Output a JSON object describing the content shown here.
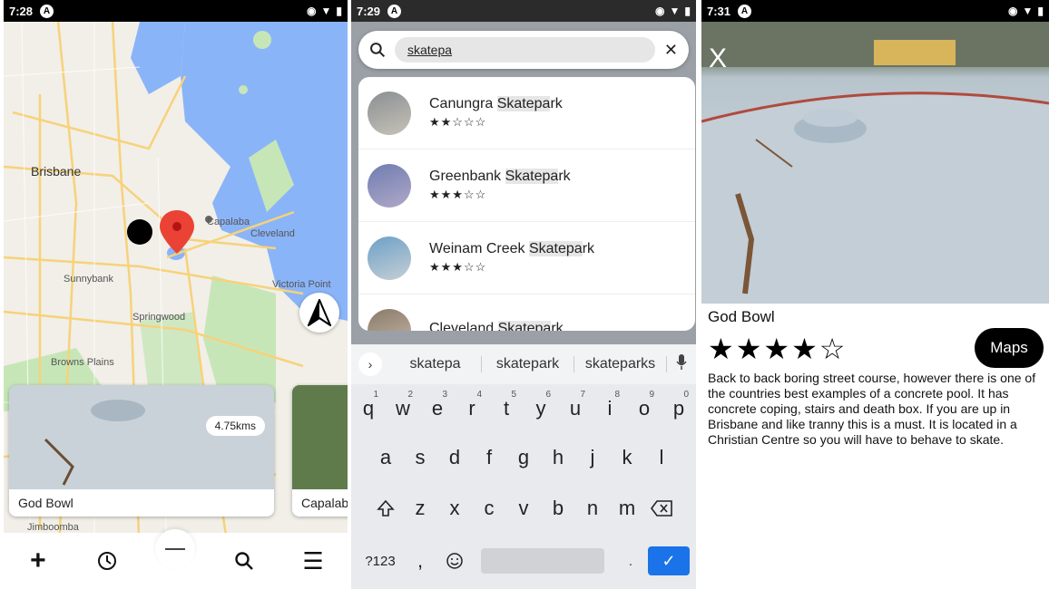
{
  "screen1": {
    "status": {
      "time": "7:28"
    },
    "map_labels": [
      "Brisbane",
      "Capalaba",
      "Cleveland",
      "Sunnybank",
      "Victoria Point",
      "Springwood",
      "Browns Plains",
      "Jimboomba"
    ],
    "cards": [
      {
        "title": "God Bowl",
        "distance": "4.75kms"
      },
      {
        "title": "Capalab"
      }
    ],
    "nav": {
      "add_icon": "+",
      "search_icon": "⚲",
      "menu_icon": "☰"
    }
  },
  "screen2": {
    "status": {
      "time": "7:29"
    },
    "search": {
      "value": "skatepa",
      "clear_icon": "✕"
    },
    "results": [
      {
        "prefix": "Canungra ",
        "match": "Skatepa",
        "rest": "rk",
        "stars": "★★☆☆☆"
      },
      {
        "prefix": "Greenbank ",
        "match": "Skatepa",
        "rest": "rk",
        "stars": "★★★☆☆"
      },
      {
        "prefix": "Weinam Creek ",
        "match": "Skatepa",
        "rest": "rk",
        "stars": "★★★☆☆"
      },
      {
        "prefix": "Cleveland ",
        "match": "Skatepa",
        "rest": "rk",
        "stars": ""
      }
    ],
    "suggestions": [
      "skatepa",
      "skatepark",
      "skateparks"
    ],
    "keyboard": {
      "row1": [
        "q",
        "w",
        "e",
        "r",
        "t",
        "y",
        "u",
        "i",
        "o",
        "p"
      ],
      "row1_nums": [
        "1",
        "2",
        "3",
        "4",
        "5",
        "6",
        "7",
        "8",
        "9",
        "0"
      ],
      "row2": [
        "a",
        "s",
        "d",
        "f",
        "g",
        "h",
        "j",
        "k",
        "l"
      ],
      "row3": [
        "z",
        "x",
        "c",
        "v",
        "b",
        "n",
        "m"
      ],
      "symbols_label": "?123",
      "comma": ","
    }
  },
  "screen3": {
    "status": {
      "time": "7:31"
    },
    "close_label": "X",
    "title": "God Bowl",
    "stars": "★★★★☆",
    "maps_label": "Maps",
    "description": "Back to back boring street course, however there is one of the countries best examples of  a concrete pool. It has concrete coping, stairs and death box.  If you are up in Brisbane and like tranny this is a must.  It is located in a Christian Centre so you will have to behave to skate."
  }
}
